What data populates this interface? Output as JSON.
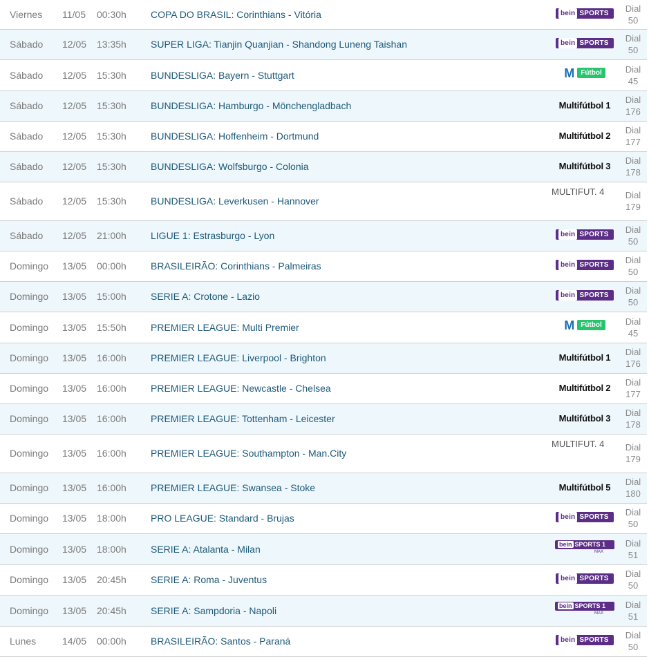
{
  "rows": [
    {
      "day": "Viernes",
      "date": "11/05",
      "time": "00:30h",
      "match": "COPA DO BRASIL: Corinthians - Vitória",
      "channel": "bein",
      "dial_label": "Dial",
      "dial": "50",
      "alt": false,
      "h": 42
    },
    {
      "day": "Sábado",
      "date": "12/05",
      "time": "13:35h",
      "match": "SUPER LIGA: Tianjin Quanjian - Shandong Luneng Taishan",
      "channel": "bein",
      "dial_label": "Dial",
      "dial": "50",
      "alt": true,
      "h": 44
    },
    {
      "day": "Sábado",
      "date": "12/05",
      "time": "15:30h",
      "match": "BUNDESLIGA: Bayern - Stuttgart",
      "channel": "movistar",
      "dial_label": "Dial",
      "dial": "45",
      "alt": false,
      "h": 45
    },
    {
      "day": "Sábado",
      "date": "12/05",
      "time": "15:30h",
      "match": "BUNDESLIGA: Hamburgo - Mönchengladbach",
      "channel": "multi",
      "channel_text": "Multifútbol 1",
      "dial_label": "Dial",
      "dial": "176",
      "alt": true,
      "h": 44
    },
    {
      "day": "Sábado",
      "date": "12/05",
      "time": "15:30h",
      "match": "BUNDESLIGA: Hoffenheim - Dortmund",
      "channel": "multi",
      "channel_text": "Multifútbol 2",
      "dial_label": "Dial",
      "dial": "177",
      "alt": false,
      "h": 44
    },
    {
      "day": "Sábado",
      "date": "12/05",
      "time": "15:30h",
      "match": "BUNDESLIGA: Wolfsburgo - Colonia",
      "channel": "multi",
      "channel_text": "Multifútbol 3",
      "dial_label": "Dial",
      "dial": "178",
      "alt": true,
      "h": 44
    },
    {
      "day": "Sábado",
      "date": "12/05",
      "time": "15:30h",
      "match": "BUNDESLIGA: Leverkusen - Hannover",
      "channel": "broken",
      "channel_text": "MULTIFUT. 4",
      "dial_label": "Dial",
      "dial": "179",
      "alt": false,
      "h": 56
    },
    {
      "day": "Sábado",
      "date": "12/05",
      "time": "21:00h",
      "match": "LIGUE 1: Estrasburgo - Lyon",
      "channel": "bein",
      "dial_label": "Dial",
      "dial": "50",
      "alt": true,
      "h": 44
    },
    {
      "day": "Domingo",
      "date": "13/05",
      "time": "00:00h",
      "match": "BRASILEIRÃO: Corinthians - Palmeiras",
      "channel": "bein",
      "dial_label": "Dial",
      "dial": "50",
      "alt": false,
      "h": 44
    },
    {
      "day": "Domingo",
      "date": "13/05",
      "time": "15:00h",
      "match": "SERIE A: Crotone - Lazio",
      "channel": "bein",
      "dial_label": "Dial",
      "dial": "50",
      "alt": true,
      "h": 44
    },
    {
      "day": "Domingo",
      "date": "13/05",
      "time": "15:50h",
      "match": "PREMIER LEAGUE: Multi Premier",
      "channel": "movistar",
      "dial_label": "Dial",
      "dial": "45",
      "alt": false,
      "h": 45
    },
    {
      "day": "Domingo",
      "date": "13/05",
      "time": "16:00h",
      "match": "PREMIER LEAGUE: Liverpool - Brighton",
      "channel": "multi",
      "channel_text": "Multifútbol 1",
      "dial_label": "Dial",
      "dial": "176",
      "alt": true,
      "h": 44
    },
    {
      "day": "Domingo",
      "date": "13/05",
      "time": "16:00h",
      "match": "PREMIER LEAGUE: Newcastle - Chelsea",
      "channel": "multi",
      "channel_text": "Multifútbol 2",
      "dial_label": "Dial",
      "dial": "177",
      "alt": false,
      "h": 44
    },
    {
      "day": "Domingo",
      "date": "13/05",
      "time": "16:00h",
      "match": "PREMIER LEAGUE: Tottenham - Leicester",
      "channel": "multi",
      "channel_text": "Multifútbol 3",
      "dial_label": "Dial",
      "dial": "178",
      "alt": true,
      "h": 44
    },
    {
      "day": "Domingo",
      "date": "13/05",
      "time": "16:00h",
      "match": "PREMIER LEAGUE: Southampton - Man.City",
      "channel": "broken",
      "channel_text": "MULTIFUT. 4",
      "dial_label": "Dial",
      "dial": "179",
      "alt": false,
      "h": 56
    },
    {
      "day": "Domingo",
      "date": "13/05",
      "time": "16:00h",
      "match": "PREMIER LEAGUE: Swansea - Stoke",
      "channel": "multi",
      "channel_text": "Multifútbol 5",
      "dial_label": "Dial",
      "dial": "180",
      "alt": true,
      "h": 44
    },
    {
      "day": "Domingo",
      "date": "13/05",
      "time": "18:00h",
      "match": "PRO LEAGUE: Standard - Brujas",
      "channel": "bein",
      "dial_label": "Dial",
      "dial": "50",
      "alt": false,
      "h": 44
    },
    {
      "day": "Domingo",
      "date": "13/05",
      "time": "18:00h",
      "match": "SERIE A: Atalanta - Milan",
      "channel": "bein1",
      "dial_label": "Dial",
      "dial": "51",
      "alt": true,
      "h": 45
    },
    {
      "day": "Domingo",
      "date": "13/05",
      "time": "20:45h",
      "match": "SERIE A: Roma - Juventus",
      "channel": "bein",
      "dial_label": "Dial",
      "dial": "50",
      "alt": false,
      "h": 44
    },
    {
      "day": "Domingo",
      "date": "13/05",
      "time": "20:45h",
      "match": "SERIE A: Sampdoria - Napoli",
      "channel": "bein1",
      "dial_label": "Dial",
      "dial": "51",
      "alt": true,
      "h": 45
    },
    {
      "day": "Lunes",
      "date": "14/05",
      "time": "00:00h",
      "match": "BRASILEIRÃO: Santos - Paraná",
      "channel": "bein",
      "dial_label": "Dial",
      "dial": "50",
      "alt": false,
      "h": 44
    }
  ],
  "logos": {
    "bein": {
      "brand": "bein",
      "label": "SPORTS",
      "color": "#5b2d86"
    },
    "bein1": {
      "brand": "bein",
      "label": "SPORTS",
      "number": "1",
      "sub": "MAX",
      "color": "#5b2d86"
    },
    "movistar": {
      "brand": "M",
      "label": "Fútbol",
      "color": "#27c46d"
    }
  }
}
